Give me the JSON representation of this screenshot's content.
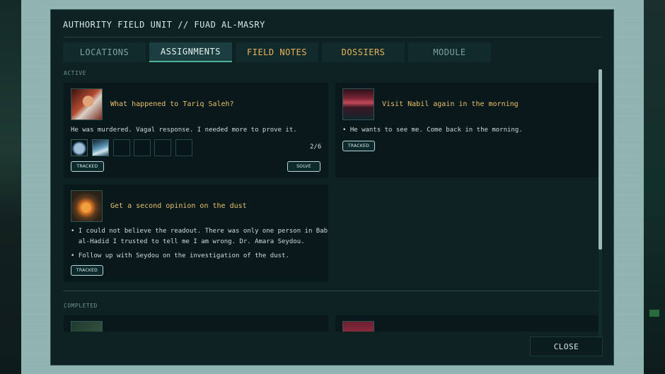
{
  "window": {
    "title": "AUTHORITY FIELD UNIT // FUAD AL-MASRY"
  },
  "tabs": [
    {
      "label": "LOCATIONS",
      "active": false
    },
    {
      "label": "ASSIGNMENTS",
      "active": true
    },
    {
      "label": "FIELD NOTES",
      "active": false
    },
    {
      "label": "DOSSIERS",
      "active": false
    },
    {
      "label": "MODULE",
      "active": false
    }
  ],
  "sections": {
    "active": "ACTIVE",
    "completed": "COMPLETED"
  },
  "assignments": [
    {
      "title": "What happened to Tariq Saleh?",
      "text": "He was murdered. Vagal response. I needed more to prove it.",
      "progress": "2/6",
      "tracked_label": "TRACKED",
      "solve_label": "SOLVE"
    },
    {
      "title": "Visit Nabil again in the morning",
      "bullets": [
        "• He wants to see me. Come back in the morning."
      ],
      "tracked_label": "TRACKED"
    },
    {
      "title": "Get a second opinion on the dust",
      "bullets": [
        "• I could not believe the readout. There was only one person in Bab",
        "  al-Hadid I trusted to tell me I am wrong. Dr. Amara Seydou.",
        "• Follow up with Seydou on the investigation of the dust."
      ],
      "tracked_label": "TRACKED"
    }
  ],
  "footer": {
    "close_label": "CLOSE"
  },
  "colors": {
    "accent_amber": "#ebc06a",
    "accent_teal": "#4fb39a",
    "panel": "#0f2223"
  }
}
